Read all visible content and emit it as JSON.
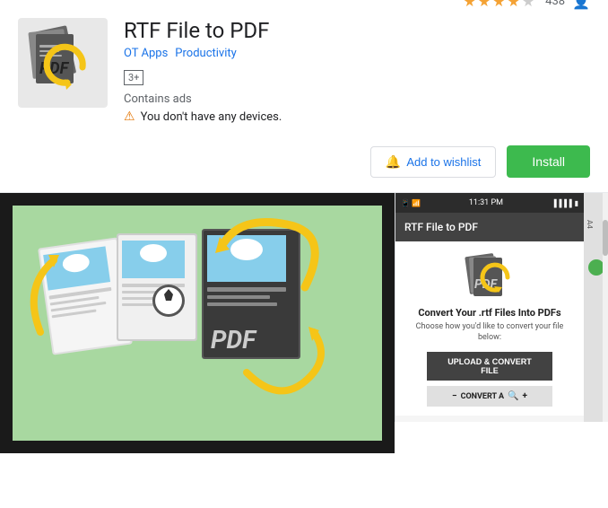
{
  "app": {
    "title": "RTF File to PDF",
    "author": "OT Apps",
    "category": "Productivity",
    "rating": 4,
    "rating_count": "438",
    "age_badge": "3+",
    "contains_ads": "Contains ads",
    "warning_text": "You don't have any devices.",
    "wishlist_label": "Add to wishlist",
    "install_label": "Install"
  },
  "phone_ui": {
    "status_time": "11:31 PM",
    "app_bar_title": "RTF File to PDF",
    "heading": "Convert Your .rtf Files Into PDFs",
    "subtext": "Choose how you'd like to convert your file below:",
    "upload_btn": "UPLOAD & CONVERT FILE",
    "convert_btn": "CONVERT A"
  },
  "icons": {
    "warning": "⚠",
    "bookmark": "🔖",
    "person": "👤",
    "signal": "▐▐▐▐",
    "battery": "▮"
  }
}
